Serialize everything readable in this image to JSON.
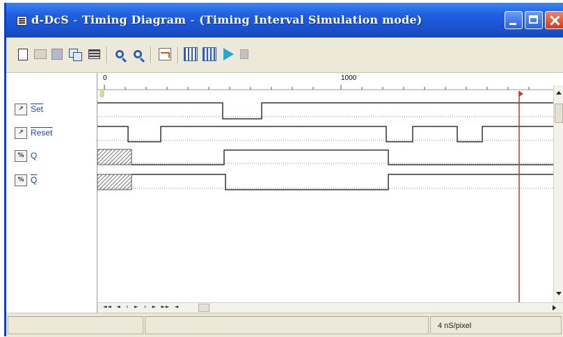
{
  "window": {
    "title_parts": [
      "d-DcS",
      "Timing Diagram",
      "(Timing Interval Simulation mode)"
    ]
  },
  "toolbar": {
    "buttons": [
      "new-icon",
      "open-icon",
      "save-icon",
      "copy-icon",
      "list-icon",
      "zoom-in-icon",
      "zoom-out-icon",
      "waveform-icon",
      "edge-icon",
      "edge-highlight-icon",
      "run-icon",
      "stop-icon"
    ]
  },
  "ruler": {
    "labels": [
      "0",
      "1000"
    ]
  },
  "signals": [
    {
      "name": "Set",
      "overbar": true,
      "icon": "input-signal-icon",
      "icon_glyph": "↗"
    },
    {
      "name": "Reset",
      "overbar": true,
      "icon": "input-signal-icon",
      "icon_glyph": "↗"
    },
    {
      "name": "Q",
      "overbar": false,
      "icon": "output-signal-icon",
      "icon_glyph": "%"
    },
    {
      "name": "Q",
      "overbar": true,
      "icon": "output-signal-icon",
      "icon_glyph": "%"
    }
  ],
  "nav": {
    "glyphs": "◄◄ ◄ ‹ ► › ► ►► ◄"
  },
  "status": {
    "scale": "4 nS/pixel"
  },
  "colors": {
    "title_bar": "#1f5fe0",
    "cursor": "#c0392b",
    "wave": "#333333",
    "signal_name": "#2244aa"
  }
}
